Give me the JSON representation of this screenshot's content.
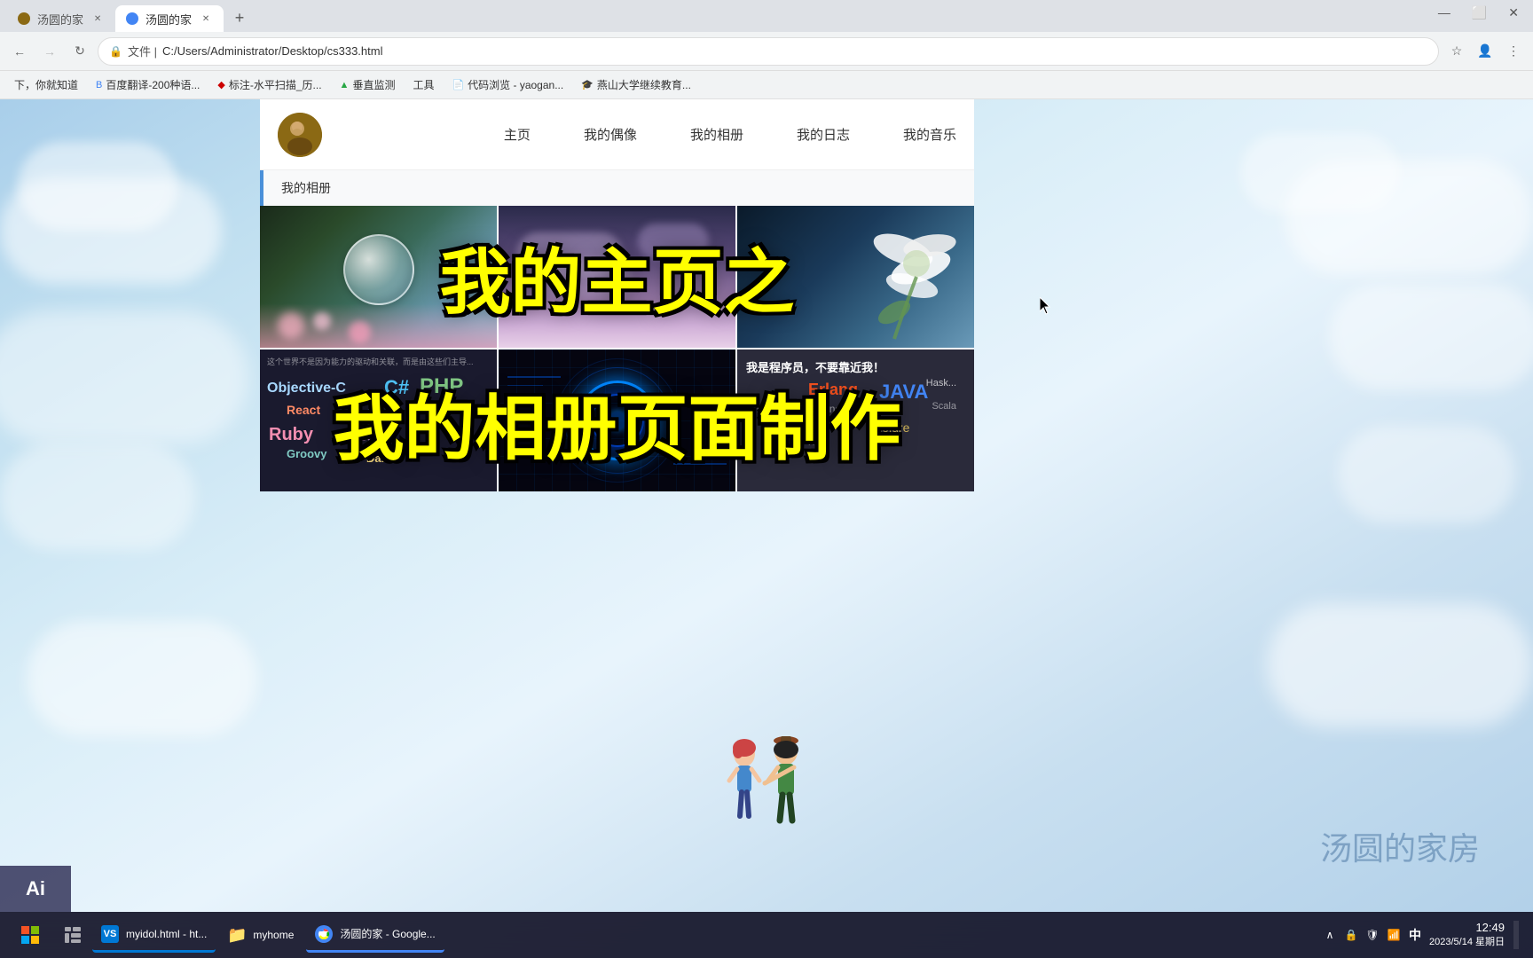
{
  "browser": {
    "tabs": [
      {
        "label": "汤圆的家",
        "active": false,
        "favicon": "circle"
      },
      {
        "label": "汤圆的家",
        "active": true,
        "favicon": "circle"
      }
    ],
    "address": "C:/Users/Administrator/Desktop/cs333.html",
    "address_prefix": "文件  |",
    "bookmarks": [
      {
        "label": "下，你就知道"
      },
      {
        "label": "百度翻译-200种语..."
      },
      {
        "label": "标注-水平扫描_历..."
      },
      {
        "label": "垂直监测"
      },
      {
        "label": "工具"
      },
      {
        "label": "代码浏览 - yaogan..."
      },
      {
        "label": "燕山大学继续教育..."
      }
    ],
    "window_controls": [
      "—",
      "☐",
      "✕"
    ]
  },
  "website": {
    "nav": {
      "items": [
        "主页",
        "我的偶像",
        "我的相册",
        "我的日志",
        "我的音乐"
      ]
    },
    "current_page": "我的相册",
    "overlay_text_1": "我的主页之",
    "overlay_text_2": "我的相册页面制作",
    "photos": [
      {
        "type": "bubble",
        "alt": "水晶球bokeh照片"
      },
      {
        "type": "sky",
        "alt": "紫色天空云朵照片"
      },
      {
        "type": "flower",
        "alt": "白色花朵照片"
      },
      {
        "type": "programming",
        "alt": "编程语言文字图"
      },
      {
        "type": "tech",
        "alt": "科技感圆形图"
      },
      {
        "type": "programmer",
        "alt": "程序员文字图"
      }
    ]
  },
  "watermark": "汤圆的家房",
  "taskbar": {
    "start_icon": "⊞",
    "items": [
      {
        "label": "myidol.html - ht...",
        "icon": "VS",
        "color": "#0078d4"
      },
      {
        "label": "myhome",
        "icon": "📁",
        "color": "#f4a825"
      },
      {
        "label": "汤圆的家 - Google...",
        "icon": "G",
        "color": "#4285f4"
      }
    ],
    "tray": {
      "icons": [
        "∧",
        "🔒",
        "🛡",
        "📶",
        "中"
      ],
      "time": "12:49",
      "date": "2023/5/14 星期日"
    }
  },
  "ai_label": "Ai"
}
